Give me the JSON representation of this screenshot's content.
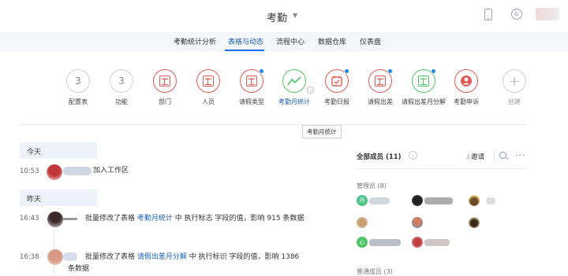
{
  "header": {
    "app_title": "考勤",
    "icons": [
      "phone-icon",
      "clock-icon",
      "user-avatar"
    ]
  },
  "tabs": [
    {
      "label": "考勤统计分析",
      "active": false
    },
    {
      "label": "表格与动态",
      "active": true
    },
    {
      "label": "流程中心",
      "active": false
    },
    {
      "label": "数据仓库",
      "active": false
    },
    {
      "label": "仪表盘",
      "active": false
    }
  ],
  "tools": [
    {
      "label": "配置表",
      "glyph": "3",
      "style": "count"
    },
    {
      "label": "功能",
      "glyph": "3",
      "style": "count"
    },
    {
      "label": "部门",
      "style": "red-sheet"
    },
    {
      "label": "人员",
      "style": "red-sheet"
    },
    {
      "label": "请假类型",
      "style": "red-sheet",
      "badge": true
    },
    {
      "label": "考勤月统计",
      "style": "green-chart",
      "active": true
    },
    {
      "label": "考勤日报",
      "style": "red-calendar",
      "badge": true
    },
    {
      "label": "请假出差",
      "style": "red-sheet",
      "badge": true
    },
    {
      "label": "请假出差月分解",
      "style": "green-sheet",
      "badge": true
    },
    {
      "label": "考勤申诉",
      "style": "red-person"
    },
    {
      "label": "创建",
      "glyph": "+",
      "style": "add"
    }
  ],
  "tooltip": "考勤月统计",
  "feed": {
    "today_label": "今天",
    "yesterday_label": "昨天",
    "entries": [
      {
        "time": "10:53",
        "text": "加入工作区"
      },
      {
        "time": "16:43",
        "prefix": "批量修改了表格",
        "link": "考勤月统计",
        "suffix": "中 执行标志 字段的值，影响 915 条数据"
      },
      {
        "time": "16:38",
        "prefix": "批量修改了表格",
        "link": "请假出差月分解",
        "suffix": "中 执行标识 字段的值，影响 1386 条数据"
      }
    ]
  },
  "members": {
    "title": "全部成员 (11)",
    "invite_label": "邀请",
    "admin_group": "管理员 (8)",
    "regular_group": "普通成员 (3)"
  },
  "colors": {
    "accent": "#1a6ff0",
    "link": "#1a5fb4",
    "red": "#e05a55",
    "green": "#4fc466",
    "badge": "#1a88e8",
    "day_header_bg": "#eef3fb"
  }
}
